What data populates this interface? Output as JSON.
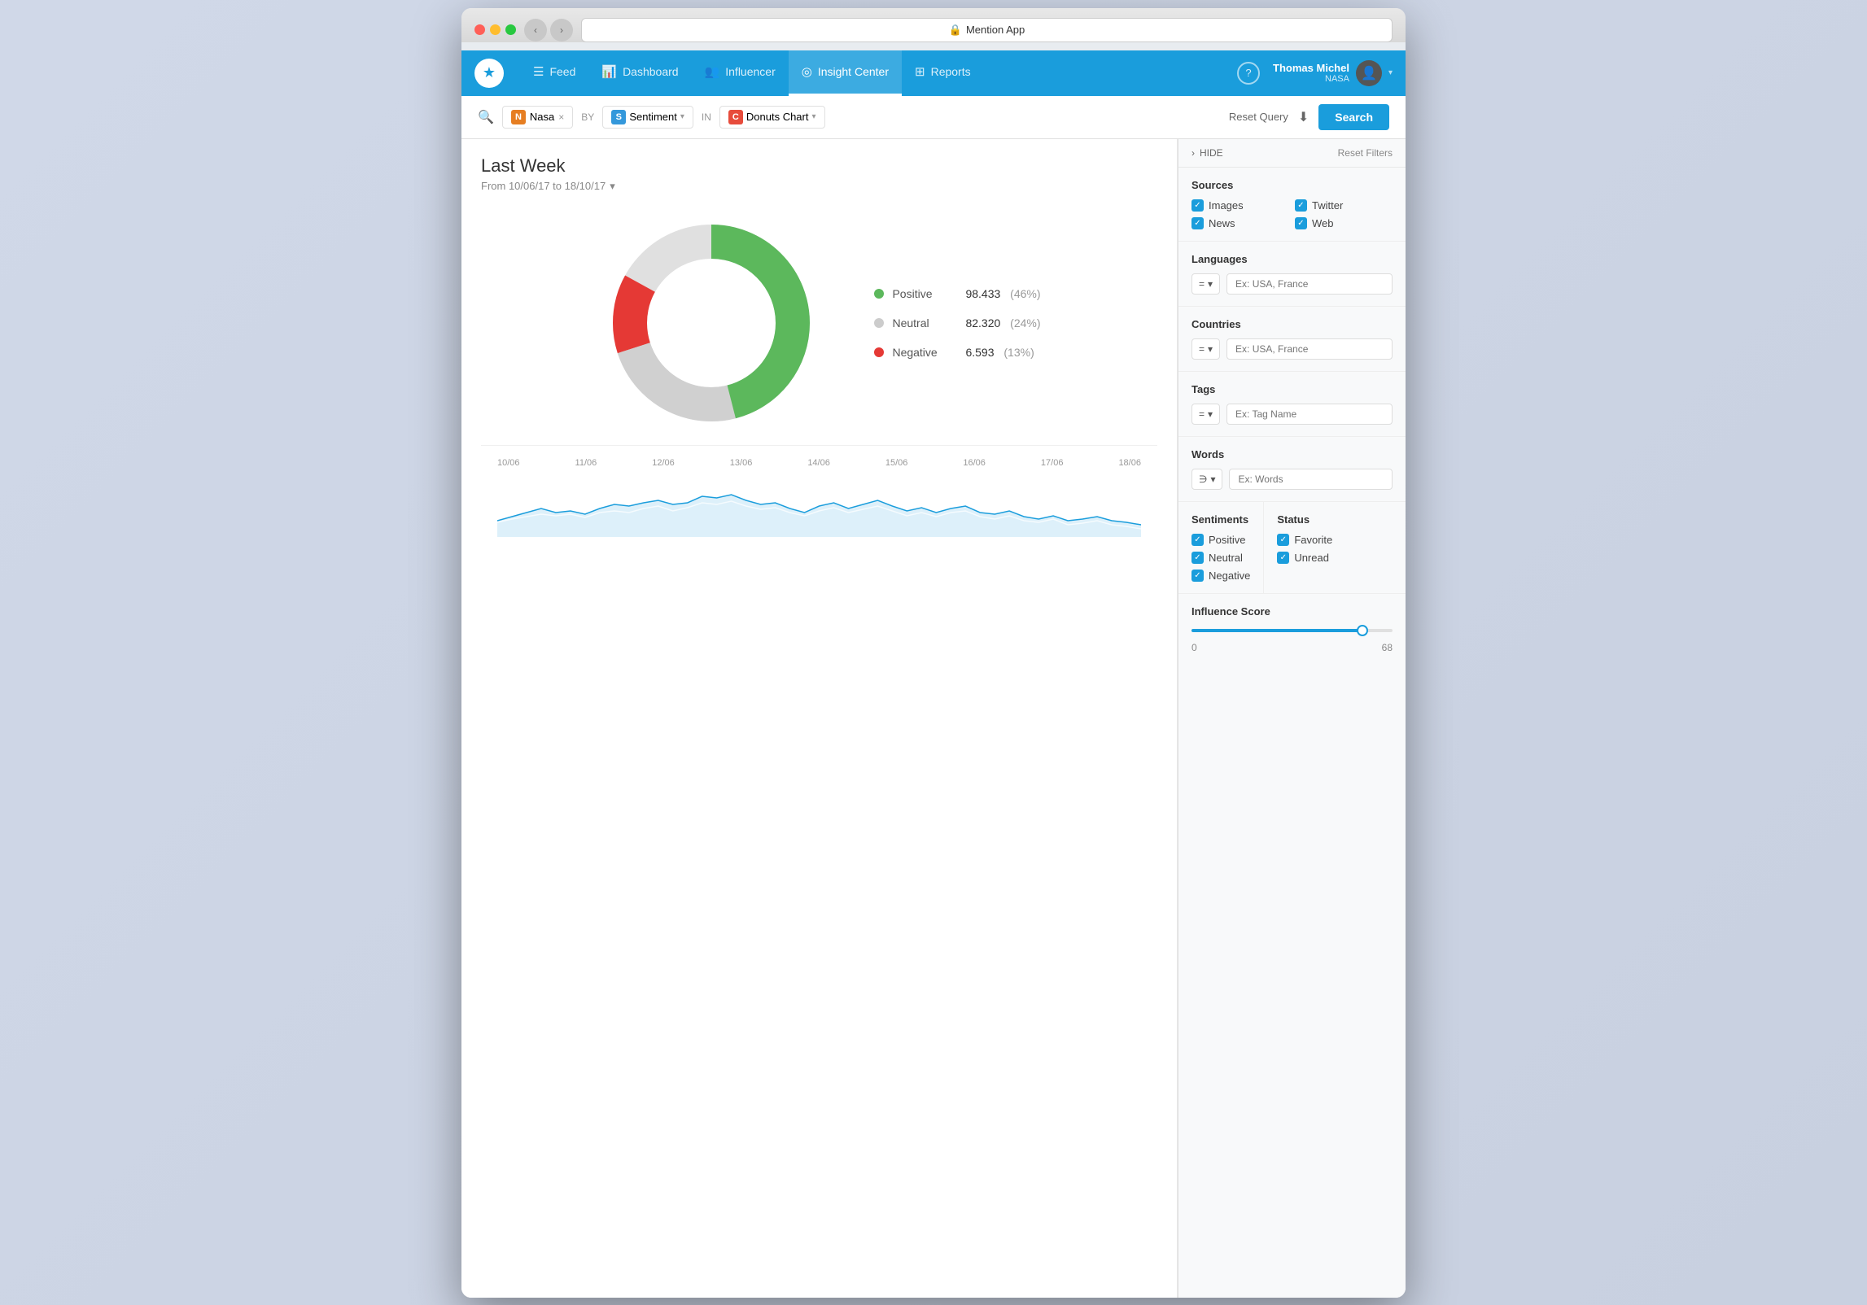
{
  "browser": {
    "address_bar_icon": "🔒",
    "address_bar_text": "Mention App"
  },
  "nav": {
    "logo_icon": "★",
    "items": [
      {
        "id": "feed",
        "icon": "☰",
        "label": "Feed"
      },
      {
        "id": "dashboard",
        "icon": "📊",
        "label": "Dashboard"
      },
      {
        "id": "influencer",
        "icon": "👥",
        "label": "Influencer"
      },
      {
        "id": "insight-center",
        "icon": "◎",
        "label": "Insight Center",
        "active": true
      },
      {
        "id": "reports",
        "icon": "⊞",
        "label": "Reports"
      }
    ],
    "help_icon": "?",
    "user": {
      "name": "Thomas Michel",
      "org": "NASA",
      "avatar_icon": "👤",
      "chevron_icon": "▾"
    }
  },
  "filter_bar": {
    "search_icon": "🔍",
    "nasa_tag": {
      "icon": "N",
      "label": "Nasa",
      "close": "×"
    },
    "by_label": "BY",
    "sentiment_tag": {
      "icon": "S",
      "label": "Sentiment",
      "chevron": "▾"
    },
    "in_label": "IN",
    "donuts_tag": {
      "icon": "C",
      "label": "Donuts Chart",
      "chevron": "▾"
    },
    "reset_query": "Reset Query",
    "download_icon": "⬇",
    "search_button": "Search"
  },
  "chart": {
    "title": "Last Week",
    "subtitle": "From 10/06/17 to 18/10/17",
    "subtitle_chevron": "▾",
    "donut": {
      "positive_value": "98.433",
      "positive_pct": "(46%)",
      "positive_color": "#5cb85c",
      "neutral_value": "82.320",
      "neutral_pct": "(24%)",
      "neutral_color": "#cccccc",
      "negative_value": "6.593",
      "negative_pct": "(13%)",
      "negative_color": "#e53935"
    },
    "legend": [
      {
        "label": "Positive",
        "value": "98.433",
        "pct": "(46%)",
        "color": "#5cb85c"
      },
      {
        "label": "Neutral",
        "value": "82.320",
        "pct": "(24%)",
        "color": "#cccccc"
      },
      {
        "label": "Negative",
        "value": "6.593",
        "pct": "(13%)",
        "color": "#e53935"
      }
    ],
    "timeline_labels": [
      "10/06",
      "11/06",
      "12/06",
      "13/06",
      "14/06",
      "15/06",
      "16/06",
      "17/06",
      "18/06"
    ]
  },
  "sidebar": {
    "hide_label": "HIDE",
    "reset_filters": "Reset Filters",
    "sources": {
      "title": "Sources",
      "items": [
        "Images",
        "Twitter",
        "News",
        "Web"
      ]
    },
    "languages": {
      "title": "Languages",
      "operator": "=",
      "placeholder": "Ex: USA, France"
    },
    "countries": {
      "title": "Countries",
      "operator": "=",
      "placeholder": "Ex: USA, France"
    },
    "tags": {
      "title": "Tags",
      "operator": "=",
      "placeholder": "Ex: Tag Name"
    },
    "words": {
      "title": "Words",
      "operator": "∋",
      "placeholder": "Ex: Words"
    },
    "sentiments": {
      "title": "Sentiments",
      "items": [
        "Positive",
        "Neutral",
        "Negative"
      ]
    },
    "status": {
      "title": "Status",
      "items": [
        "Favorite",
        "Unread"
      ]
    },
    "influence_score": {
      "title": "Influence Score",
      "min": "0",
      "max": "68",
      "fill_pct": "85"
    }
  }
}
